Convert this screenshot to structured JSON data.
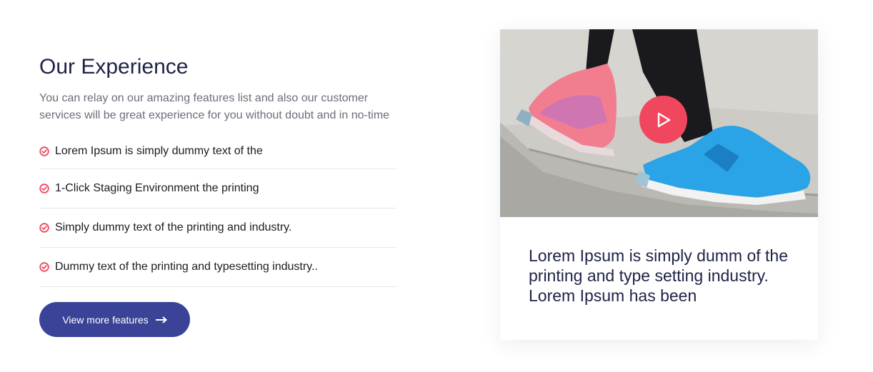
{
  "section": {
    "title": "Our Experience",
    "description": "You can relay on our amazing features list and also our customer services will be great experience for you without doubt and in no-time"
  },
  "features": [
    {
      "icon": "check-circle-icon",
      "label": "Lorem Ipsum is simply dummy text of the"
    },
    {
      "icon": "check-circle-icon",
      "label": "1-Click Staging Environment the printing"
    },
    {
      "icon": "check-circle-icon",
      "label": "Simply dummy text of the printing and industry."
    },
    {
      "icon": "check-circle-icon",
      "label": "Dummy text of the printing and typesetting industry.."
    }
  ],
  "cta": {
    "label": "View more features",
    "icon": "arrow-right-icon"
  },
  "video_card": {
    "play_icon": "play-icon",
    "caption": "Lorem Ipsum is simply dumm of the printing and type setting industry. Lorem Ipsum has been"
  },
  "colors": {
    "heading": "#1e2347",
    "accent": "#f0475e",
    "button": "#3a4397",
    "body_text": "#6b6e7a"
  }
}
